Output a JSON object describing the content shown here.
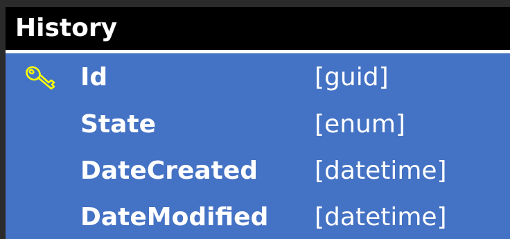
{
  "entity": {
    "title": "History",
    "fields": [
      {
        "name": "Id",
        "type": "[guid]",
        "icon": "key-icon",
        "primary_key": true
      },
      {
        "name": "State",
        "type": "[enum]",
        "icon": "",
        "primary_key": false
      },
      {
        "name": "DateCreated",
        "type": "[datetime]",
        "icon": "",
        "primary_key": false
      },
      {
        "name": "DateModified",
        "type": "[datetime]",
        "icon": "",
        "primary_key": false
      }
    ]
  },
  "colors": {
    "background": "#2b2b2b",
    "header": "#000000",
    "body": "#4472c4",
    "text": "#ffffff",
    "key_icon": "#ffff00"
  }
}
